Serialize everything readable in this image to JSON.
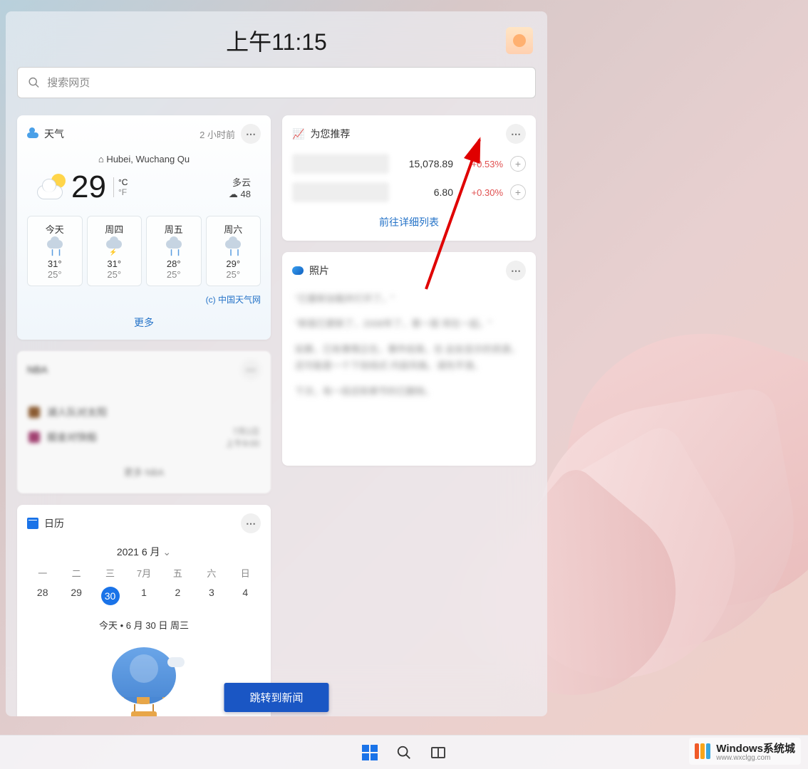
{
  "header": {
    "clock": "上午11:15"
  },
  "search": {
    "placeholder": "搜索网页"
  },
  "weather": {
    "title": "天气",
    "updated": "2 小时前",
    "location": "Hubei, Wuchang Qu",
    "temp": "29",
    "unit_c": "°C",
    "unit_f": "°F",
    "condition": "多云",
    "extra_label": "☁ 48",
    "forecast": [
      {
        "label": "今天",
        "hi": "31°",
        "lo": "25°"
      },
      {
        "label": "周四",
        "hi": "31°",
        "lo": "25°"
      },
      {
        "label": "周五",
        "hi": "28°",
        "lo": "25°"
      },
      {
        "label": "周六",
        "hi": "29°",
        "lo": "25°"
      }
    ],
    "source": "(c) 中国天气网",
    "more": "更多"
  },
  "recommend": {
    "title": "为您推荐",
    "rows": [
      {
        "value": "15,078.89",
        "change": "+0.53%"
      },
      {
        "value": "6.80",
        "change": "+0.30%"
      }
    ],
    "link": "前往详细列表"
  },
  "photos": {
    "title": "照片"
  },
  "nba": {
    "title": "NBA",
    "row1": "湖人队对太阳",
    "row2": "掘金对快船",
    "time1": "7月1日",
    "time2": "上午9:00",
    "footer": "更多 NBA"
  },
  "calendar": {
    "title": "日历",
    "month": "2021 6 月",
    "dow": [
      "一",
      "二",
      "三",
      "7月",
      "五",
      "六",
      "日"
    ],
    "days": [
      "28",
      "29",
      "30",
      "1",
      "2",
      "3",
      "4"
    ],
    "today_index": 2,
    "today_line": "今天 • 6 月 30 日 周三"
  },
  "news_button": "跳转到新闻",
  "watermark": {
    "title": "Windows系统城",
    "url": "www.wxclgg.com",
    "bars": [
      "#f05a28",
      "#f9a51a",
      "#3aa6dd"
    ]
  }
}
